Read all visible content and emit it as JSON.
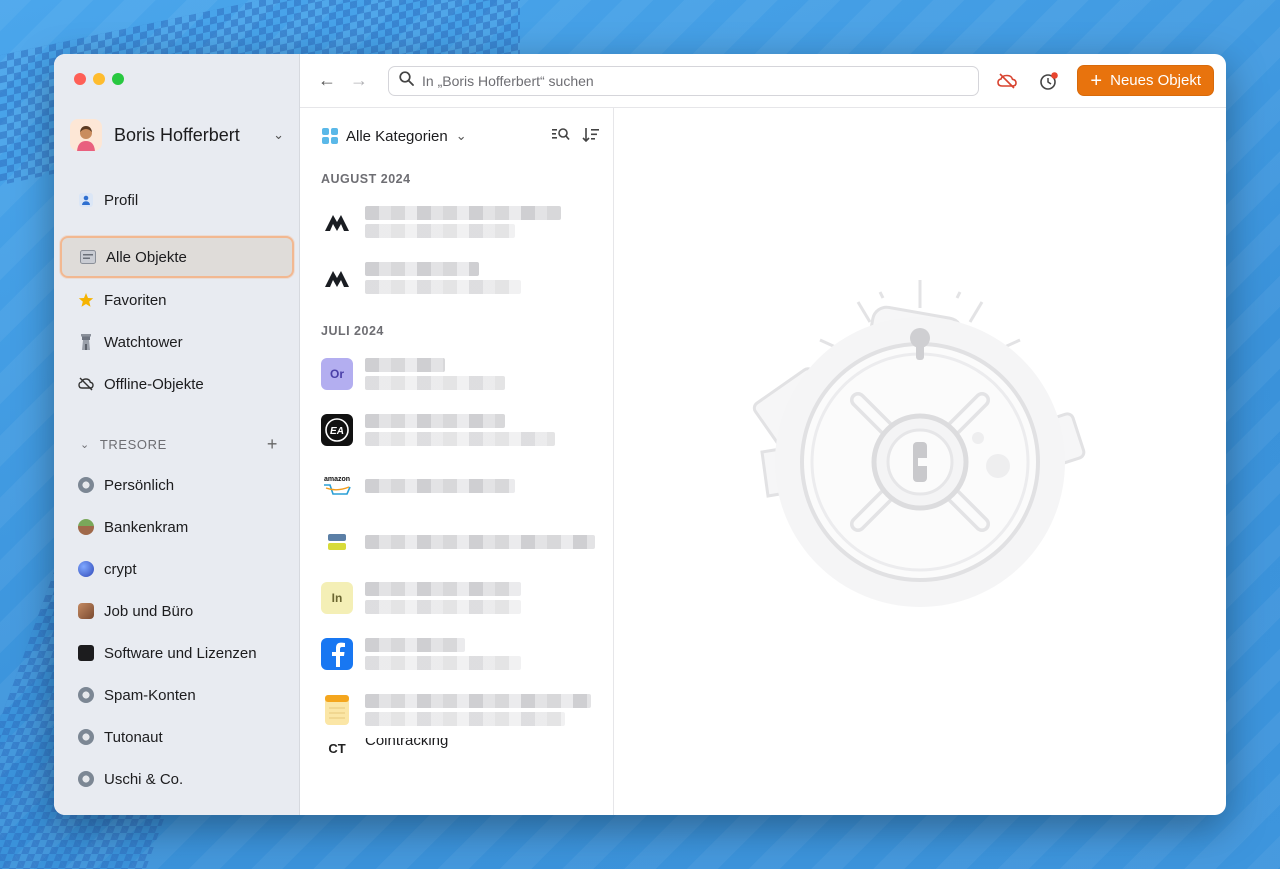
{
  "account": {
    "name": "Boris Hofferbert"
  },
  "sidebar": {
    "profile": "Profil",
    "nav": [
      {
        "label": "Alle Objekte",
        "icon": "all-items-icon",
        "active": true
      },
      {
        "label": "Favoriten",
        "icon": "star-icon"
      },
      {
        "label": "Watchtower",
        "icon": "watchtower-icon"
      },
      {
        "label": "Offline-Objekte",
        "icon": "offline-icon"
      }
    ],
    "vaults_title": "TRESORE",
    "vaults": [
      {
        "label": "Persönlich",
        "color": "#7c8794"
      },
      {
        "label": "Bankenkram",
        "color": "#7aa85a"
      },
      {
        "label": "crypt",
        "color": "#4b6fd6"
      },
      {
        "label": "Job und Büro",
        "color": "#a0694a"
      },
      {
        "label": "Software und Lizenzen",
        "color": "#1c1c1e"
      },
      {
        "label": "Spam-Konten",
        "color": "#7c8794"
      },
      {
        "label": "Tutonaut",
        "color": "#7c8794"
      },
      {
        "label": "Uschi & Co.",
        "color": "#7c8794"
      }
    ]
  },
  "toolbar": {
    "search_placeholder": "In „Boris Hofferbert“ suchen",
    "new_item_label": "Neues Objekt"
  },
  "list": {
    "category": "Alle Kategorien",
    "groups": [
      {
        "month": "AUGUST 2024"
      },
      {
        "month": "JULI 2024"
      }
    ],
    "icons": {
      "or": "Or",
      "in": "In",
      "amazon": "amazon"
    },
    "partial_item": "Cointracking"
  },
  "colors": {
    "accent": "#e8730d",
    "sidebar_bg": "#e8ebf1",
    "selection_border": "#f2b891"
  }
}
